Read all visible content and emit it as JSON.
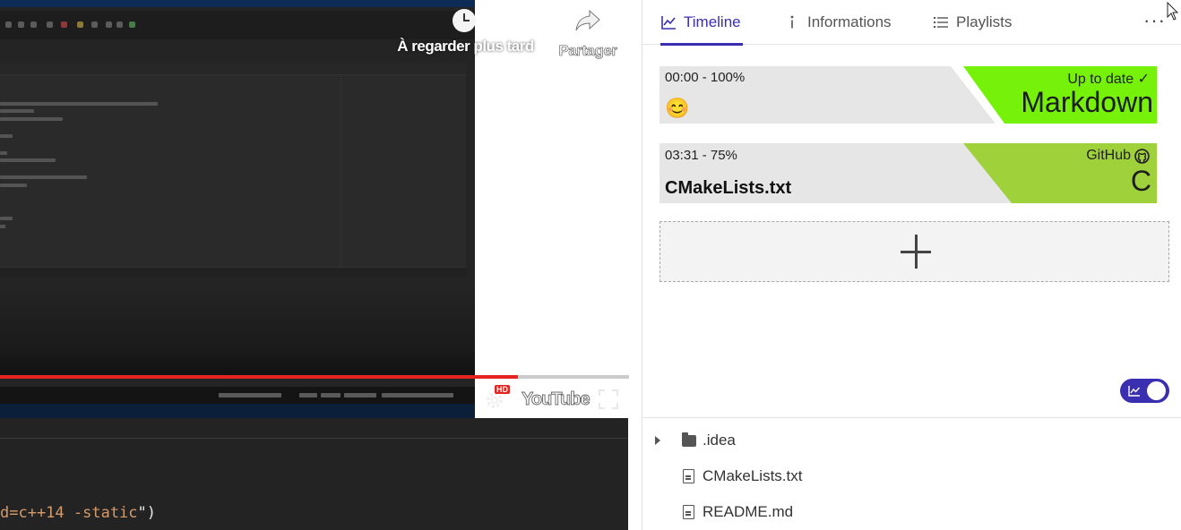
{
  "player": {
    "watch_later_label": "À regarder plus tard",
    "share_label": "Partager",
    "quality_badge": "HD",
    "logo_text": "YouTube",
    "progress_played": 0.823,
    "progress_buffered": 0.823,
    "statusbar_theme": "Material Theme - Darker"
  },
  "terminal": {
    "line_text": "d=c++14 -static",
    "line_close": "\")"
  },
  "tabs": [
    {
      "label": "Timeline",
      "icon": "chart-line-icon",
      "active": true
    },
    {
      "label": "Informations",
      "icon": "info-icon",
      "active": false
    },
    {
      "label": "Playlists",
      "icon": "list-icon",
      "active": false
    }
  ],
  "more_menu_label": "···",
  "timeline": {
    "cards": [
      {
        "timestamp": "00:00 - 100%",
        "title": "😊",
        "badge_top": "Up to date ✓",
        "badge_main": "Markdown",
        "badge_color": "#76f20a"
      },
      {
        "timestamp": "03:31 - 75%",
        "title": "CMakeLists.txt",
        "badge_top": "GitHub",
        "badge_main": "C",
        "badge_color": "#9fd13b"
      }
    ],
    "add_label": "+"
  },
  "toggle_on": true,
  "accent_color": "#3a2fb0",
  "file_tree": [
    {
      "name": ".idea",
      "type": "folder"
    },
    {
      "name": "CMakeLists.txt",
      "type": "file"
    },
    {
      "name": "README.md",
      "type": "file"
    }
  ]
}
